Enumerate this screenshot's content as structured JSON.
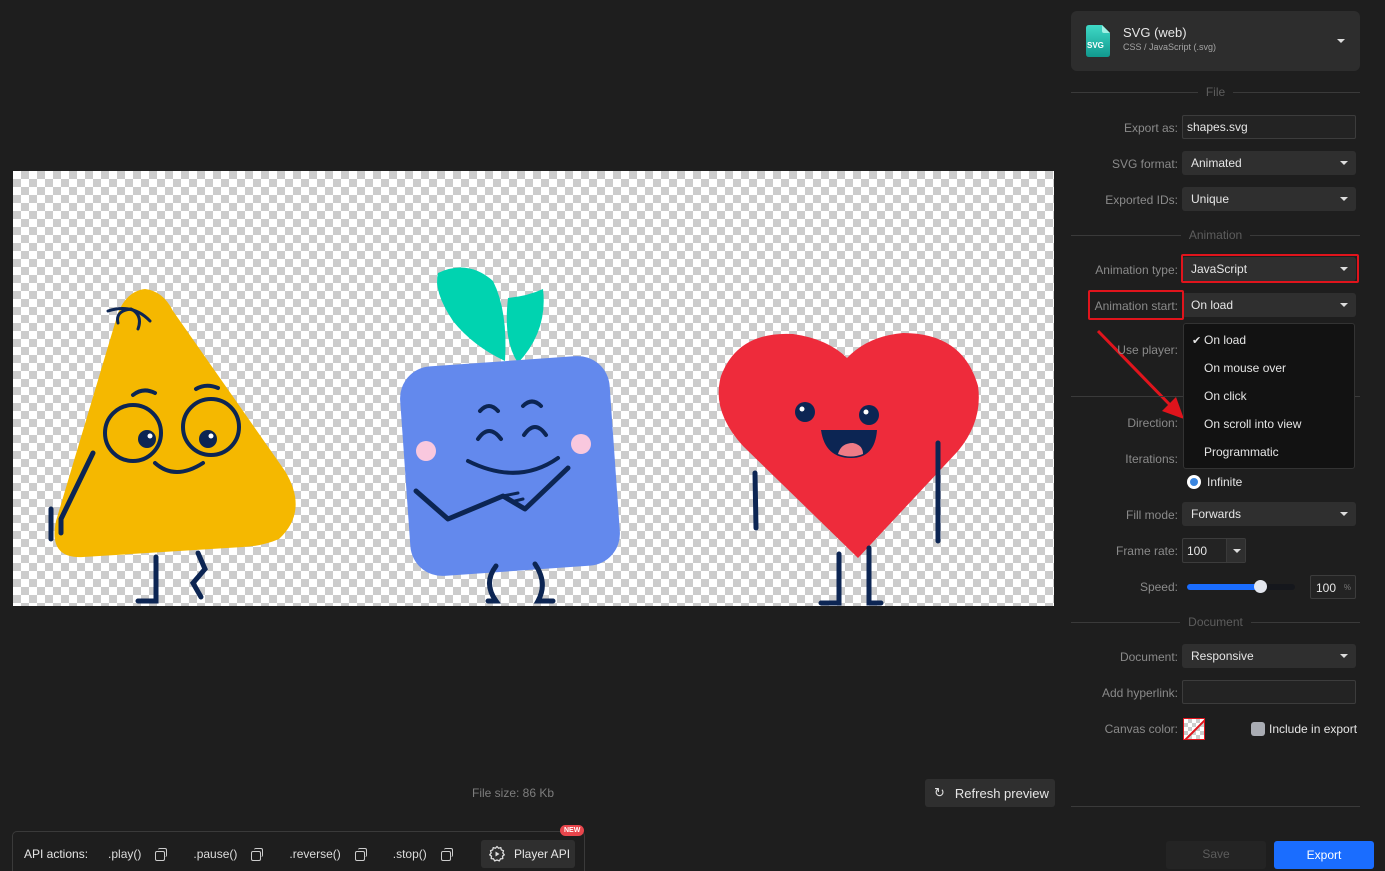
{
  "preview": {
    "file_size": "File size: 86 Kb",
    "refresh_label": "Refresh preview",
    "characters": [
      "triangle-character",
      "square-character",
      "heart-character"
    ],
    "colors": {
      "triangle": "#f5b800",
      "square": "#6389ed",
      "leaves": "#00d3b0",
      "heart": "#ee2b3b",
      "outline": "#0c2553",
      "cheeks": "#f9c8de",
      "tongue": "#ef7b86"
    }
  },
  "api_bar": {
    "label": "API actions:",
    "actions": [
      {
        "name": ".play()"
      },
      {
        "name": ".pause()"
      },
      {
        "name": ".reverse()"
      },
      {
        "name": ".stop()"
      }
    ],
    "player_api_label": "Player API",
    "new_badge": "NEW"
  },
  "format": {
    "icon_text": "SVG",
    "title": "SVG (web)",
    "subtitle": "CSS / JavaScript (.svg)"
  },
  "sections": {
    "file": "File",
    "animation": "Animation",
    "document": "Document"
  },
  "file": {
    "export_as_label": "Export as:",
    "export_as_value": "shapes.svg",
    "svg_format_label": "SVG format:",
    "svg_format_value": "Animated",
    "exported_ids_label": "Exported IDs:",
    "exported_ids_value": "Unique"
  },
  "animation": {
    "type_label": "Animation type:",
    "type_value": "JavaScript",
    "start_label": "Animation start:",
    "start_value": "On load",
    "start_options": [
      "On load",
      "On mouse over",
      "On click",
      "On scroll into view",
      "Programmatic"
    ],
    "start_selected_check": "✔",
    "use_player_label": "Use player:",
    "direction_label": "Direction:",
    "iterations_label": "Iterations:",
    "iterations_value": "Infinite",
    "fill_mode_label": "Fill mode:",
    "fill_mode_value": "Forwards",
    "frame_rate_label": "Frame rate:",
    "frame_rate_value": "100",
    "speed_label": "Speed:",
    "speed_value": "100",
    "speed_unit": "%",
    "speed_slider_fraction": 0.68
  },
  "document": {
    "document_label": "Document:",
    "document_value": "Responsive",
    "hyperlink_label": "Add hyperlink:",
    "hyperlink_value": "",
    "canvas_color_label": "Canvas color:",
    "include_in_export_label": "Include in export"
  },
  "footer": {
    "save_label": "Save",
    "export_label": "Export"
  },
  "annotation": {
    "highlight_color": "#e0141c"
  }
}
